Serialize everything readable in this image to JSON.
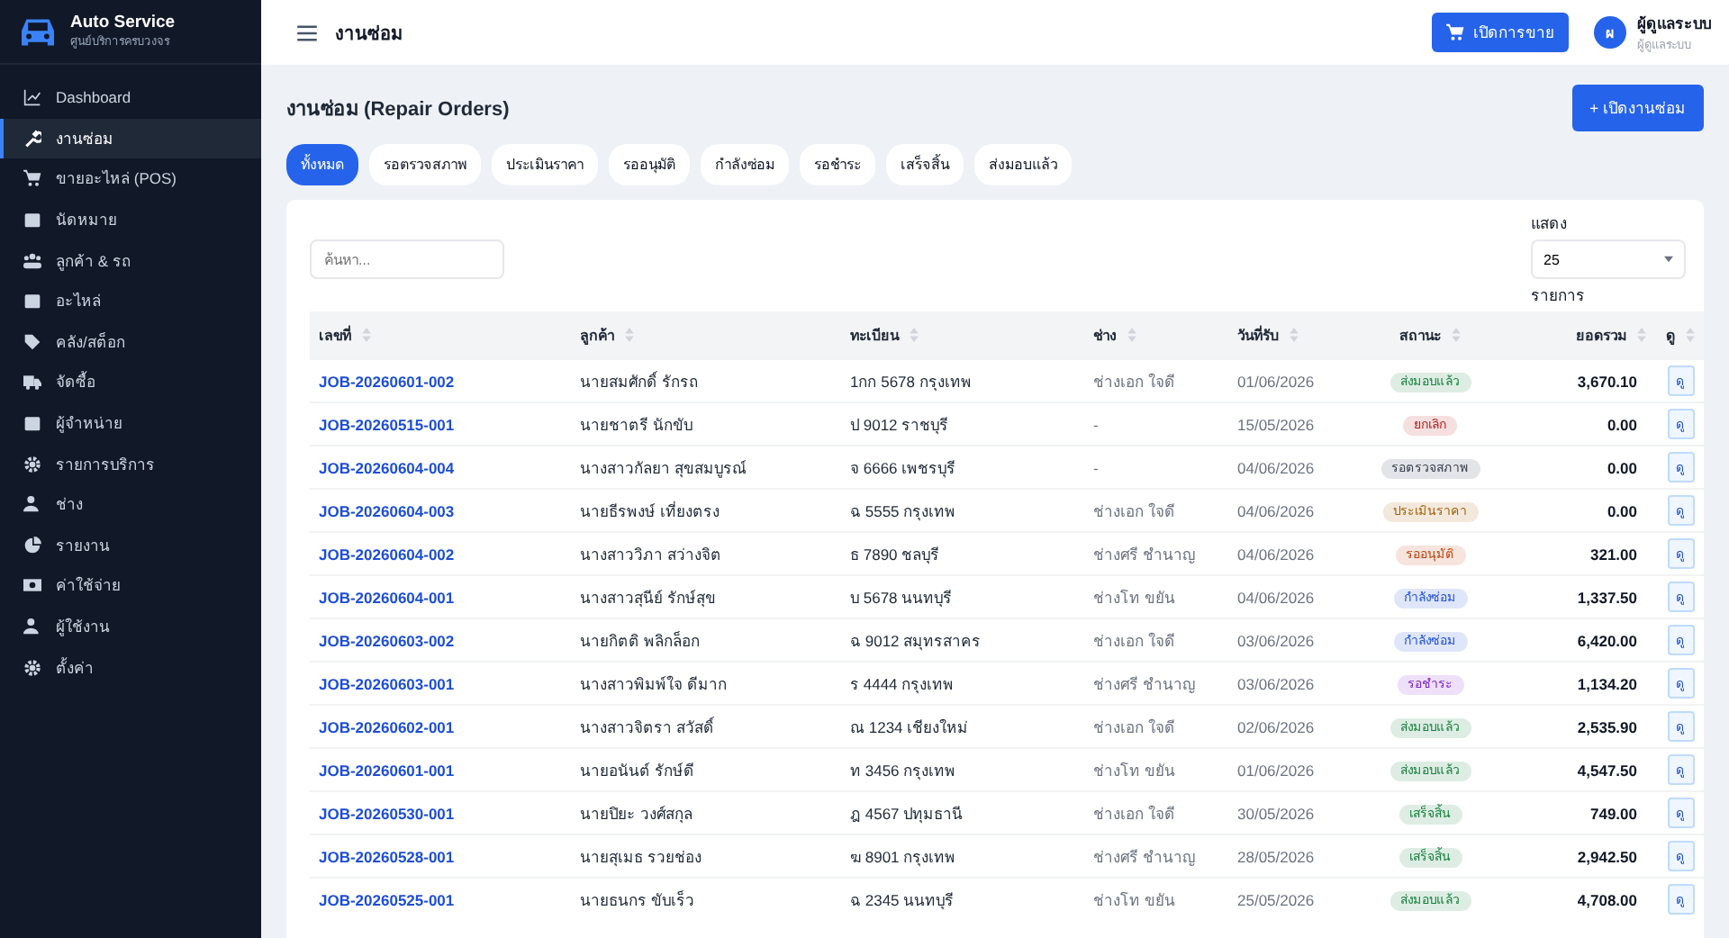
{
  "brand": {
    "name": "Auto Service",
    "tagline": "ศูนย์บริการครบวงจร"
  },
  "sidebar": {
    "items": [
      {
        "label": "Dashboard",
        "selected": false
      },
      {
        "label": "งานซ่อม",
        "selected": true
      },
      {
        "label": "ขายอะไหล่ (POS)",
        "selected": false
      },
      {
        "label": "นัดหมาย",
        "selected": false
      },
      {
        "label": "ลูกค้า & รถ",
        "selected": false
      },
      {
        "label": "อะไหล่",
        "selected": false
      },
      {
        "label": "คลัง/สต็อก",
        "selected": false
      },
      {
        "label": "จัดซื้อ",
        "selected": false
      },
      {
        "label": "ผู้จำหน่าย",
        "selected": false
      },
      {
        "label": "รายการบริการ",
        "selected": false
      },
      {
        "label": "ช่าง",
        "selected": false
      },
      {
        "label": "รายงาน",
        "selected": false
      },
      {
        "label": "ค่าใช้จ่าย",
        "selected": false
      },
      {
        "label": "ผู้ใช้งาน",
        "selected": false
      },
      {
        "label": "ตั้งค่า",
        "selected": false
      }
    ]
  },
  "header": {
    "title": "งานซ่อม",
    "pos_button": "เปิดการขาย",
    "user": {
      "initial": "ผ",
      "name": "ผู้ดูแลระบบ",
      "role": "ผู้ดูแลระบบ"
    }
  },
  "page": {
    "title": "งานซ่อม (Repair Orders)",
    "new_button": "+ เปิดงานซ่อม"
  },
  "tabs": [
    {
      "label": "ทั้งหมด",
      "selected": true
    },
    {
      "label": "รอตรวจสภาพ",
      "selected": false
    },
    {
      "label": "ประเมินราคา",
      "selected": false
    },
    {
      "label": "รออนุมัติ",
      "selected": false
    },
    {
      "label": "กำลังซ่อม",
      "selected": false
    },
    {
      "label": "รอชำระ",
      "selected": false
    },
    {
      "label": "เสร็จสิ้น",
      "selected": false
    },
    {
      "label": "ส่งมอบแล้ว",
      "selected": false
    }
  ],
  "search": {
    "placeholder": "ค้นหา..."
  },
  "page_size": {
    "label": "แสดง",
    "value": "25",
    "suffix": "รายการ"
  },
  "table": {
    "columns": [
      "เลขที่",
      "ลูกค้า",
      "ทะเบียน",
      "ช่าง",
      "วันที่รับ",
      "สถานะ",
      "ยอดรวม",
      "ดู"
    ],
    "rows": [
      {
        "job": "JOB-20260601-002",
        "customer": "นายสมศักดิ์ รักรถ",
        "plate": "1กก 5678 กรุงเทพ",
        "mechanic": "ช่างเอก ใจดี",
        "date": "01/06/2026",
        "status": "ส่งมอบแล้ว",
        "color": "#15803d",
        "total": "3,670.10",
        "action": "ดู"
      },
      {
        "job": "JOB-20260515-001",
        "customer": "นายชาตรี นักขับ",
        "plate": "ป 9012 ราชบุรี",
        "mechanic": "-",
        "date": "15/05/2026",
        "status": "ยกเลิก",
        "color": "#b91c1c",
        "total": "0.00",
        "action": "ดู"
      },
      {
        "job": "JOB-20260604-004",
        "customer": "นางสาวกัลยา สุขสมบูรณ์",
        "plate": "จ 6666 เพชรบุรี",
        "mechanic": "-",
        "date": "04/06/2026",
        "status": "รอตรวจสภาพ",
        "color": "#374151",
        "total": "0.00",
        "action": "ดู"
      },
      {
        "job": "JOB-20260604-003",
        "customer": "นายธีรพงษ์ เที่ยงตรง",
        "plate": "ฉ 5555 กรุงเทพ",
        "mechanic": "ช่างเอก ใจดี",
        "date": "04/06/2026",
        "status": "ประเมินราคา",
        "color": "#a16207",
        "total": "0.00",
        "action": "ดู"
      },
      {
        "job": "JOB-20260604-002",
        "customer": "นางสาววิภา สว่างจิต",
        "plate": "ธ 7890 ชลบุรี",
        "mechanic": "ช่างศรี ชำนาญ",
        "date": "04/06/2026",
        "status": "รออนุมัติ",
        "color": "#c2410c",
        "total": "321.00",
        "action": "ดู"
      },
      {
        "job": "JOB-20260604-001",
        "customer": "นางสาวสุนีย์ รักษ์สุข",
        "plate": "บ 5678 นนทบุรี",
        "mechanic": "ช่างโท ขยัน",
        "date": "04/06/2026",
        "status": "กำลังซ่อม",
        "color": "#1d4ed8",
        "total": "1,337.50",
        "action": "ดู"
      },
      {
        "job": "JOB-20260603-002",
        "customer": "นายกิตติ พลิกล็อก",
        "plate": "ฉ 9012 สมุทรสาคร",
        "mechanic": "ช่างเอก ใจดี",
        "date": "03/06/2026",
        "status": "กำลังซ่อม",
        "color": "#1d4ed8",
        "total": "6,420.00",
        "action": "ดู"
      },
      {
        "job": "JOB-20260603-001",
        "customer": "นางสาวพิมพ์ใจ ดีมาก",
        "plate": "ร 4444 กรุงเทพ",
        "mechanic": "ช่างศรี ชำนาญ",
        "date": "03/06/2026",
        "status": "รอชำระ",
        "color": "#7e22ce",
        "total": "1,134.20",
        "action": "ดู"
      },
      {
        "job": "JOB-20260602-001",
        "customer": "นางสาวจิตรา สวัสดิ์",
        "plate": "ณ 1234 เชียงใหม่",
        "mechanic": "ช่างเอก ใจดี",
        "date": "02/06/2026",
        "status": "ส่งมอบแล้ว",
        "color": "#15803d",
        "total": "2,535.90",
        "action": "ดู"
      },
      {
        "job": "JOB-20260601-001",
        "customer": "นายอนันต์ รักษ์ดี",
        "plate": "ท 3456 กรุงเทพ",
        "mechanic": "ช่างโท ขยัน",
        "date": "01/06/2026",
        "status": "ส่งมอบแล้ว",
        "color": "#15803d",
        "total": "4,547.50",
        "action": "ดู"
      },
      {
        "job": "JOB-20260530-001",
        "customer": "นายปิยะ วงศ์สกุล",
        "plate": "ฎ 4567 ปทุมธานี",
        "mechanic": "ช่างเอก ใจดี",
        "date": "30/05/2026",
        "status": "เสร็จสิ้น",
        "color": "#15803d",
        "total": "749.00",
        "action": "ดู"
      },
      {
        "job": "JOB-20260528-001",
        "customer": "นายสุเมธ รวยช่อง",
        "plate": "ฆ 8901 กรุงเทพ",
        "mechanic": "ช่างศรี ชำนาญ",
        "date": "28/05/2026",
        "status": "เสร็จสิ้น",
        "color": "#15803d",
        "total": "2,942.50",
        "action": "ดู"
      },
      {
        "job": "JOB-20260525-001",
        "customer": "นายธนกร ขับเร็ว",
        "plate": "ฉ 2345 นนทบุรี",
        "mechanic": "ช่างโท ขยัน",
        "date": "25/05/2026",
        "status": "ส่งมอบแล้ว",
        "color": "#15803d",
        "total": "4,708.00",
        "action": "ดู"
      }
    ]
  }
}
